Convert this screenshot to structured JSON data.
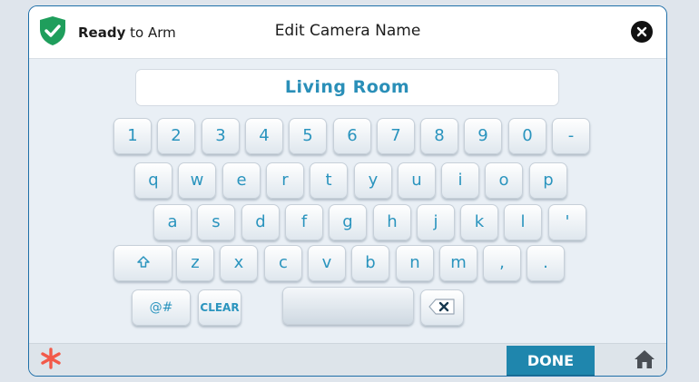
{
  "header": {
    "status_bold": "Ready",
    "status_rest": " to Arm",
    "title": "Edit Camera Name"
  },
  "input": {
    "value": "Living Room"
  },
  "keyboard": {
    "row1": [
      "1",
      "2",
      "3",
      "4",
      "5",
      "6",
      "7",
      "8",
      "9",
      "0",
      "-"
    ],
    "row2": [
      "q",
      "w",
      "e",
      "r",
      "t",
      "y",
      "u",
      "i",
      "o",
      "p"
    ],
    "row3": [
      "a",
      "s",
      "d",
      "f",
      "g",
      "h",
      "j",
      "k",
      "l",
      "'"
    ],
    "row4": [
      "z",
      "x",
      "c",
      "v",
      "b",
      "n",
      "m",
      ",",
      "."
    ],
    "symbols_label": "@#",
    "clear_label": "CLEAR"
  },
  "footer": {
    "done_label": "DONE"
  },
  "colors": {
    "accent": "#1f86ad",
    "key_text": "#2a94be",
    "shield_green": "#1f9e5c",
    "alert_star": "#f25a4a"
  },
  "icons": {
    "status": "shield-check-icon",
    "close": "close-icon",
    "shift": "shift-arrow-icon",
    "backspace": "backspace-icon",
    "alert": "asterisk-icon",
    "home": "home-icon"
  }
}
